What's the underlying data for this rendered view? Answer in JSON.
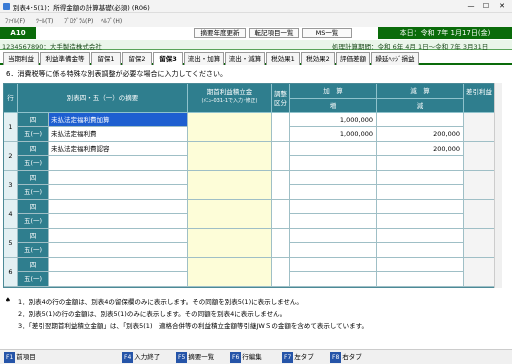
{
  "window": {
    "title": "別表4･5(1)：所得金額の計算基礎(必須) (R06)",
    "minimize": "—",
    "maximize": "☐",
    "close": "✕"
  },
  "menu": [
    "ﾌｧｲﾙ(F)",
    "ﾂｰﾙ(T)",
    "ﾌﾟﾛｸﾞﾗﾑ(P)",
    "ﾍﾙﾌﾟ(H)"
  ],
  "header": {
    "code": "A10",
    "btn_update": "摘要年度更新",
    "btn_transfer": "転記項目一覧",
    "btn_ms": "MS一覧",
    "today": "本日：令和 7年 1月17日(金)"
  },
  "company": {
    "name": "1234567890：大手製造株式会社",
    "period": "処理計算期間：令和 6年 4月 1日～令和 7年 3月31日"
  },
  "tabs": [
    "当期利益",
    "利益準備金等",
    "留保1",
    "留保2",
    "留保3",
    "流出・加算",
    "流出・減算",
    "税効果1",
    "税効果2",
    "評価差額",
    "繰延ﾍｯｼﾞ損益"
  ],
  "active_tab": "留保3",
  "condition": "6．消費税等に係る特殊な別表調整が必要な場合に入力してください。",
  "grid_header": {
    "row": "行",
    "desc": "別表四・五（一）の摘要",
    "early": "期首利益積立金",
    "early_sub": "(ﾒﾆｭｰ031-1で入力･修正)",
    "adjust": "調整区分",
    "add": "加　算",
    "add_sub": "増",
    "sub": "減　算",
    "sub_sub": "減",
    "right": "差引利益"
  },
  "rows": [
    {
      "no": "1",
      "type_a": "四",
      "type_b": "五(一)",
      "desc_a": "未払法定福利費加算",
      "desc_b": "未払法定福利費",
      "add_a": "1,000,000",
      "add_b": "1,000,000",
      "sub_a": "",
      "sub_b": "200,000"
    },
    {
      "no": "2",
      "type_a": "四",
      "type_b": "五(一)",
      "desc_a": "未払法定福利費認容",
      "desc_b": "",
      "add_a": "",
      "add_b": "",
      "sub_a": "200,000",
      "sub_b": ""
    },
    {
      "no": "3",
      "type_a": "四",
      "type_b": "五(一)",
      "desc_a": "",
      "desc_b": "",
      "add_a": "",
      "add_b": "",
      "sub_a": "",
      "sub_b": ""
    },
    {
      "no": "4",
      "type_a": "四",
      "type_b": "五(一)",
      "desc_a": "",
      "desc_b": "",
      "add_a": "",
      "add_b": "",
      "sub_a": "",
      "sub_b": ""
    },
    {
      "no": "5",
      "type_a": "四",
      "type_b": "五(一)",
      "desc_a": "",
      "desc_b": "",
      "add_a": "",
      "add_b": "",
      "sub_a": "",
      "sub_b": ""
    },
    {
      "no": "6",
      "type_a": "四",
      "type_b": "五(一)",
      "desc_a": "",
      "desc_b": "",
      "add_a": "",
      "add_b": "",
      "sub_a": "",
      "sub_b": ""
    }
  ],
  "notes": {
    "mark": "♠",
    "n1": "1．別表4の行の金額は、別表4の留保欄のみに表示します。その同額を別表5(1)に表示しません。",
    "n2": "2．別表5(1)の行の金額は、別表5(1)のみに表示します。その同額を別表4に表示しません。",
    "n3": "3．「差引翌期首利益積立金額」は、「別表5(1)　適格合併等の利益積立金額等引継JWＳの金額を含めて表示しています。"
  },
  "fkeys": [
    {
      "k": "F1",
      "l": "前項目"
    },
    {
      "k": "F4",
      "l": "入力終了"
    },
    {
      "k": "F5",
      "l": "摘要一覧"
    },
    {
      "k": "F6",
      "l": "行編集"
    },
    {
      "k": "F7",
      "l": "左タブ"
    },
    {
      "k": "F8",
      "l": "右タブ"
    }
  ]
}
